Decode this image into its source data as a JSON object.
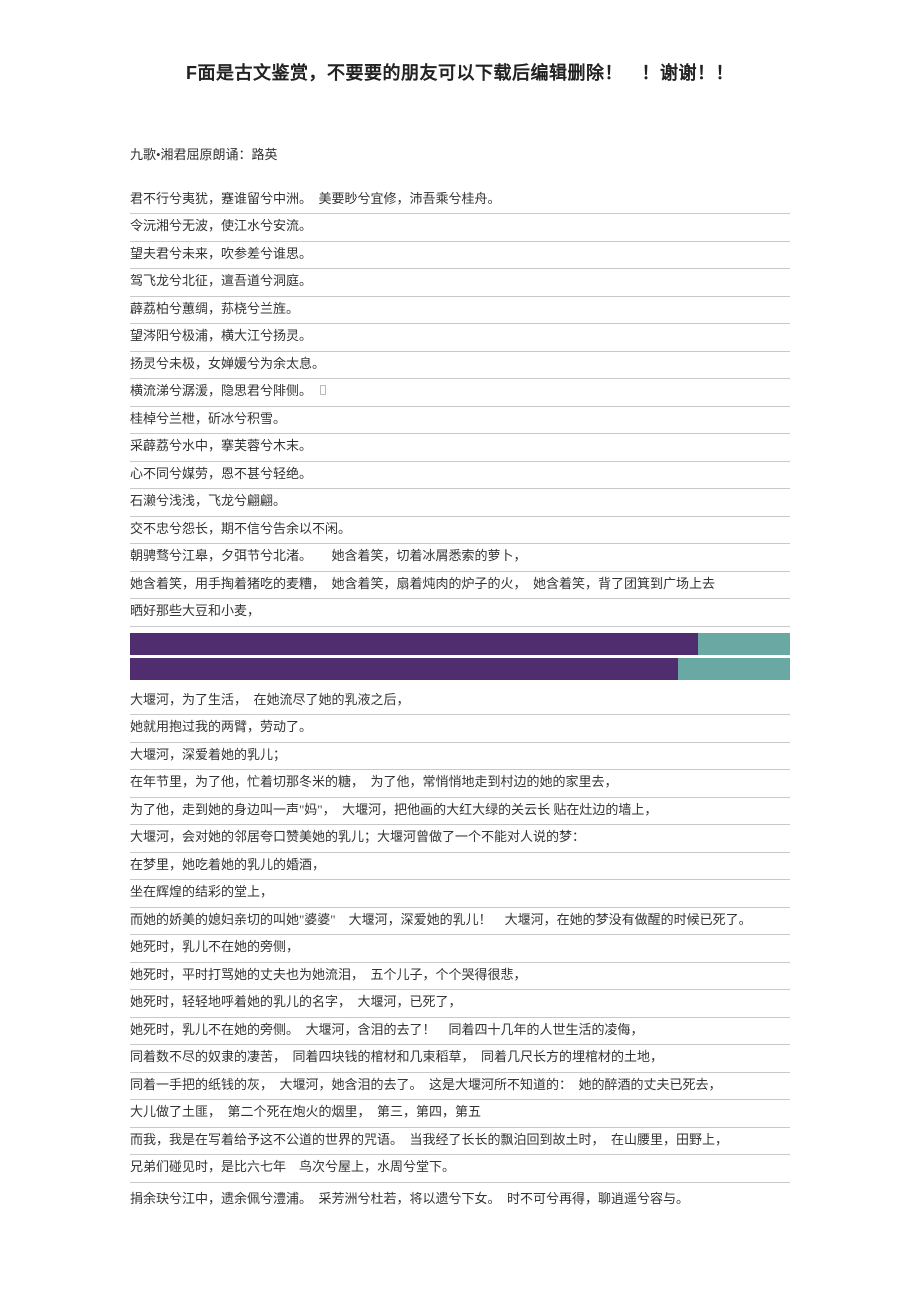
{
  "title": "F面是古文鉴赏，不要要的朋友可以下载后编辑删除！　！谢谢！！",
  "subtitle": "九歌•湘君屈原朗诵：路英",
  "lines1": [
    "君不行兮夷犹，蹇谁留兮中洲。　美要眇兮宜修，沛吾乘兮桂舟。",
    "令沅湘兮无波，使江水兮安流。",
    "望夫君兮未来，吹参差兮谁思。",
    "驾飞龙兮北征，邅吾道兮洞庭。",
    "薜荔柏兮蕙绸，荪桡兮兰旌。",
    "望涔阳兮极浦，横大江兮扬灵。",
    "扬灵兮未极，女婵媛兮为余太息。",
    "横流涕兮潺湲，隐思君兮陫侧。",
    "桂棹兮兰枻，斫冰兮积雪。",
    "采薜荔兮水中，搴芙蓉兮木末。",
    "心不同兮媒劳，恩不甚兮轻绝。",
    "石濑兮浅浅，飞龙兮翩翩。",
    "交不忠兮怨长，期不信兮告余以不闲。",
    "朝骋骛兮江皋，夕弭节兮北渚。　　她含着笑，切着冰屑悉索的萝卜，",
    "她含着笑，用手掏着猪吃的麦糟，　她含着笑，扇着炖肉的炉子的火，　她含着笑，背了团箕到广场上去",
    "晒好那些大豆和小麦，"
  ],
  "lines2": [
    "大堰河，为了生活，　在她流尽了她的乳液之后，",
    "她就用抱过我的两臂，劳动了。",
    "大堰河，深爱着她的乳儿；",
    "在年节里，为了他，忙着切那冬米的糖，　为了他，常悄悄地走到村边的她的家里去，",
    "为了他，走到她的身边叫一声\"妈\"，　大堰河，把他画的大红大绿的关云长 贴在灶边的墙上，",
    "大堰河，会对她的邻居夸口赞美她的乳儿；大堰河曾做了一个不能对人说的梦：",
    "在梦里，她吃着她的乳儿的婚酒，",
    "坐在辉煌的结彩的堂上，",
    "而她的娇美的媳妇亲切的叫她\"婆婆\"　大堰河，深爱她的乳儿！　大堰河，在她的梦没有做醒的时候已死了。",
    "她死时，乳儿不在她的旁侧，",
    "她死时，平时打骂她的丈夫也为她流泪，　五个儿子，个个哭得很悲，",
    "她死时，轻轻地呼着她的乳儿的名字，　大堰河，已死了，",
    "她死时，乳儿不在她的旁侧。　大堰河，含泪的去了！　同着四十几年的人世生活的凌侮，",
    "同着数不尽的奴隶的凄苦，　同着四块钱的棺材和几束稻草，　同着几尺长方的埋棺材的土地，",
    "同着一手把的纸钱的灰，　大堰河，她含泪的去了。　这是大堰河所不知道的：　她的醉酒的丈夫已死去，",
    "大儿做了土匪，　第二个死在炮火的烟里，　第三，第四，第五",
    "而我，我是在写着给予这不公道的世界的咒语。　当我经了长长的飘泊回到故土时，　在山腰里，田野上，",
    "兄弟们碰见时，是比六七年　鸟次兮屋上，水周兮堂下。"
  ],
  "lines3": [
    "捐余玦兮江中，遗余佩兮澧浦。　采芳洲兮杜若，将以遗兮下女。　时不可兮再得，聊逍遥兮容与。"
  ]
}
